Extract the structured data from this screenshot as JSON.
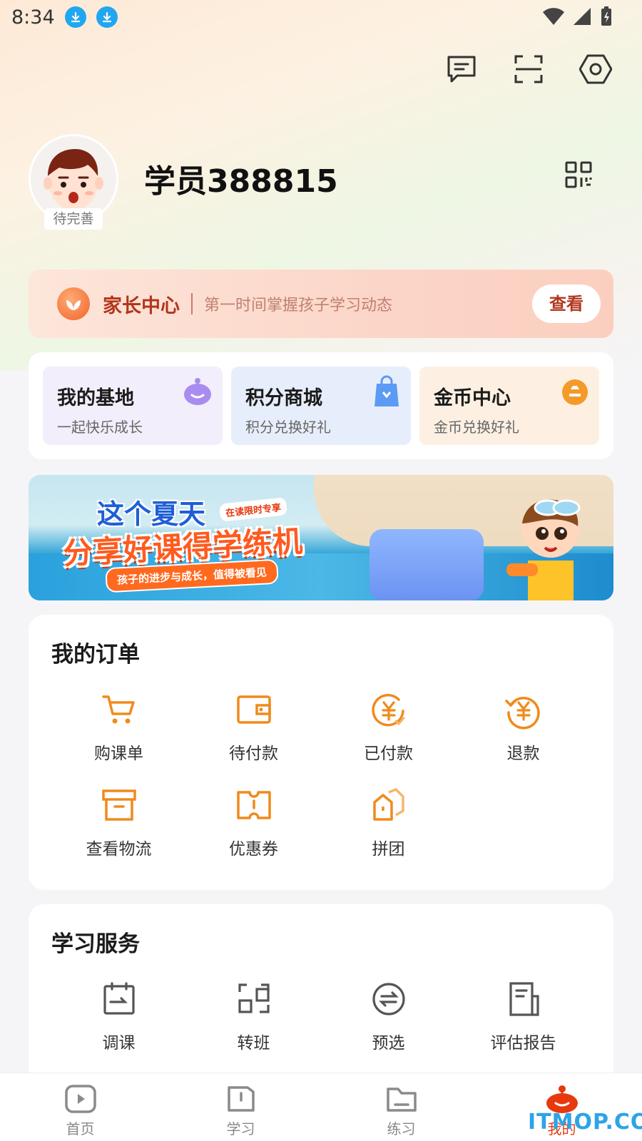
{
  "status_bar": {
    "time": "8:34"
  },
  "profile": {
    "username": "学员388815",
    "avatar_tag": "待完善"
  },
  "parent_center": {
    "title": "家长中心",
    "description": "第一时间掌握孩子学习动态",
    "button": "查看"
  },
  "quick_links": [
    {
      "title": "我的基地",
      "subtitle": "一起快乐成长"
    },
    {
      "title": "积分商城",
      "subtitle": "积分兑换好礼"
    },
    {
      "title": "金币中心",
      "subtitle": "金币兑换好礼"
    }
  ],
  "banner": {
    "line1": "这个夏天",
    "tag": "在读限时专享",
    "line2": "分享好课得学练机",
    "pill": "孩子的进步与成长，值得被看见"
  },
  "orders": {
    "title": "我的订单",
    "items": [
      {
        "label": "购课单",
        "icon": "cart-icon"
      },
      {
        "label": "待付款",
        "icon": "wallet-icon"
      },
      {
        "label": "已付款",
        "icon": "yuan-check-icon"
      },
      {
        "label": "退款",
        "icon": "yuan-refund-icon"
      },
      {
        "label": "查看物流",
        "icon": "box-icon"
      },
      {
        "label": "优惠券",
        "icon": "coupon-icon"
      },
      {
        "label": "拼团",
        "icon": "group-icon"
      }
    ]
  },
  "services": {
    "title": "学习服务",
    "items": [
      {
        "label": "调课",
        "icon": "calendar-icon"
      },
      {
        "label": "转班",
        "icon": "transfer-icon"
      },
      {
        "label": "预选",
        "icon": "swap-icon"
      },
      {
        "label": "评估报告",
        "icon": "report-icon"
      }
    ]
  },
  "tabs": [
    {
      "label": "首页",
      "icon": "play-icon"
    },
    {
      "label": "学习",
      "icon": "book-icon"
    },
    {
      "label": "练习",
      "icon": "folder-icon"
    },
    {
      "label": "我的",
      "icon": "mascot-icon",
      "active": true
    }
  ],
  "watermark": "ITMOP.COM",
  "colors": {
    "accent": "#f08a1c",
    "brand_red": "#e8380d",
    "parent_text": "#b2361c"
  }
}
